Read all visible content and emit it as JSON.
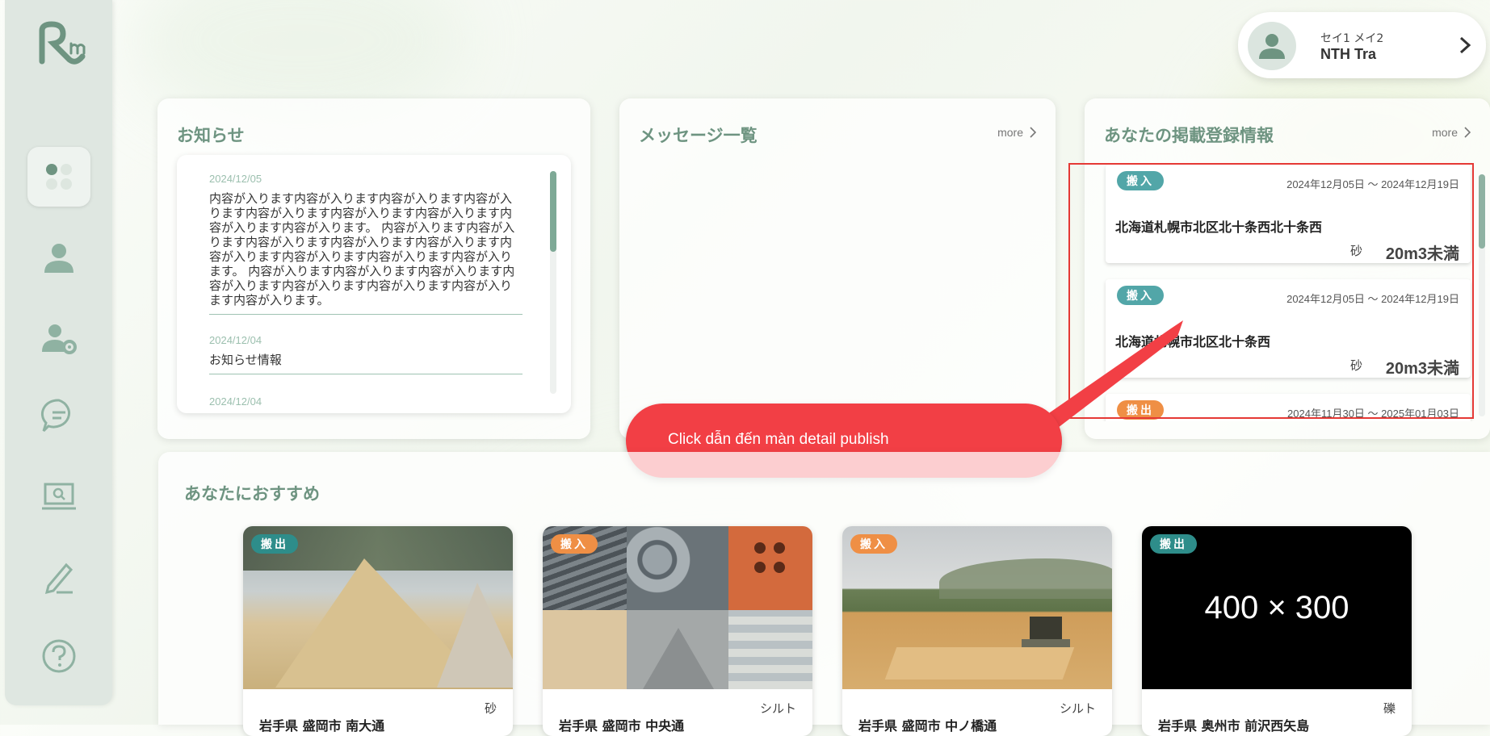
{
  "user": {
    "kana": "セイ1 メイ2",
    "name": "NTH Tra"
  },
  "news": {
    "title": "お知らせ",
    "items": [
      {
        "date": "2024/12/05",
        "body": "内容が入ります内容が入ります内容が入ります内容が入ります内容が入ります内容が入ります内容が入ります内容が入ります内容が入ります。 内容が入ります内容が入ります内容が入ります内容が入ります内容が入ります内容が入ります内容が入ります内容が入ります内容が入ります。 内容が入ります内容が入ります内容が入ります内容が入ります内容が入ります内容が入ります内容が入ります内容が入ります。"
      },
      {
        "date": "2024/12/04",
        "body": "お知らせ情報"
      },
      {
        "date": "2024/12/04",
        "body": ""
      }
    ]
  },
  "messages": {
    "title": "メッセージ一覧",
    "more": "more"
  },
  "listings": {
    "title": "あなたの掲載登録情報",
    "more": "more",
    "items": [
      {
        "badge": "搬入",
        "dates": "2024年12月05日 ～ 2024年12月19日",
        "address": "北海道札幌市北区北十条西北十条西",
        "material": "砂",
        "volume": "20m3未満"
      },
      {
        "badge": "搬入",
        "dates": "2024年12月05日 ～ 2024年12月19日",
        "address": "北海道札幌市北区北十条西",
        "material": "砂",
        "volume": "20m3未満"
      },
      {
        "badge": "搬出",
        "dates": "2024年11月30日 ～ 2025年01月03日",
        "address": "",
        "material": "",
        "volume": ""
      }
    ]
  },
  "callout": {
    "text": "Click dẫn đến màn detail publish"
  },
  "recommend": {
    "title": "あなたにおすすめ",
    "cards": [
      {
        "badge": "搬出",
        "material": "砂",
        "address": "岩手県 盛岡市 南大通",
        "image": "sand-pile-photo"
      },
      {
        "badge": "搬入",
        "material": "シルト",
        "address": "岩手県 盛岡市 中央通",
        "image": "building-materials-photo"
      },
      {
        "badge": "搬入",
        "material": "シルト",
        "address": "岩手県 盛岡市 中ノ橋通",
        "image": "construction-site-photo"
      },
      {
        "badge": "搬出",
        "material": "礫",
        "address": "岩手県 奥州市 前沢西矢島",
        "image_text": "400 × 300"
      }
    ]
  },
  "colors": {
    "accent": "#6e9481",
    "badge_teal": "#52a6a8",
    "badge_orange": "#ef8f45",
    "annotation_red": "#f23f45"
  }
}
